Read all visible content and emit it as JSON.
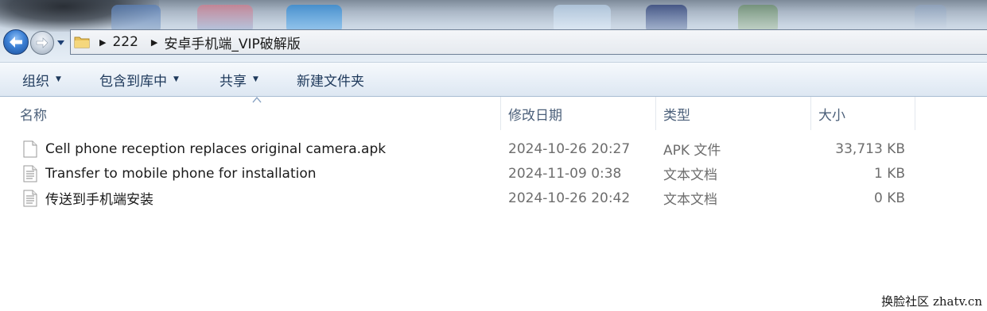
{
  "address_bar": {
    "crumbs": [
      "222",
      "安卓手机端_VIP破解版"
    ]
  },
  "toolbar": {
    "organize_label": "组织",
    "include_in_library_label": "包含到库中",
    "share_label": "共享",
    "new_folder_label": "新建文件夹"
  },
  "columns": {
    "name": "名称",
    "date_modified": "修改日期",
    "type": "类型",
    "size": "大小"
  },
  "files": [
    {
      "name": "Cell phone reception replaces original camera.apk",
      "date": "2024-10-26 20:27",
      "type": "APK 文件",
      "size": "33,713 KB",
      "icon": "blank-file-icon"
    },
    {
      "name": "Transfer to mobile phone for installation",
      "date": "2024-11-09 0:38",
      "type": "文本文档",
      "size": "1 KB",
      "icon": "text-file-icon"
    },
    {
      "name": "传送到手机端安装",
      "date": "2024-10-26 20:42",
      "type": "文本文档",
      "size": "0 KB",
      "icon": "text-file-icon"
    }
  ],
  "watermark": "换脸社区 zhatv.cn",
  "colors": {
    "toolbar_text": "#1e395b",
    "header_text": "#4c607a",
    "secondary_text": "#6d6d6d",
    "back_button": "#3b7fd4"
  }
}
